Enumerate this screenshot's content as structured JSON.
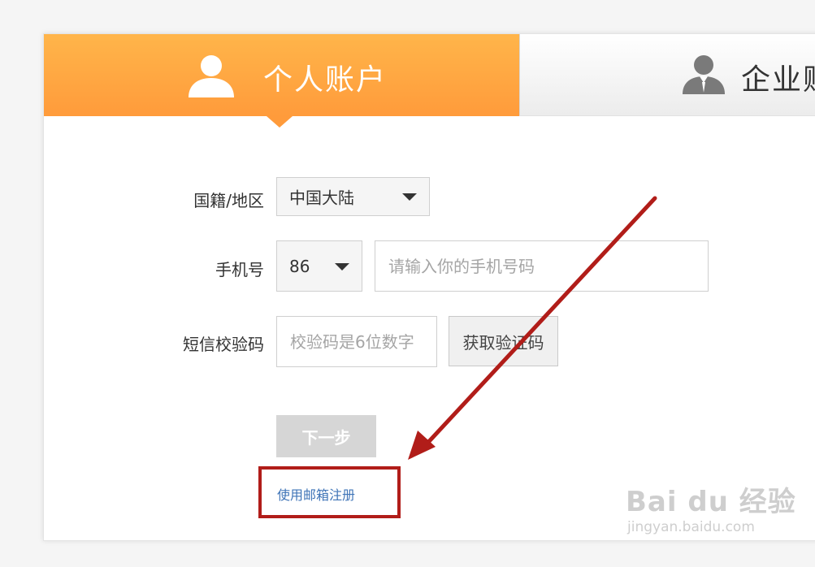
{
  "tabs": {
    "personal": {
      "label": "个人账户",
      "icon": "user-icon",
      "active": true
    },
    "company": {
      "label": "企业账户",
      "icon": "business-user-icon",
      "active": false
    }
  },
  "form": {
    "region": {
      "label": "国籍/地区",
      "value": "中国大陆"
    },
    "phone": {
      "label": "手机号",
      "country_code": "86",
      "placeholder": "请输入你的手机号码"
    },
    "sms": {
      "label": "短信校验码",
      "placeholder": "校验码是6位数字",
      "button": "获取验证码"
    },
    "next_button": "下一步",
    "email_link": "使用邮箱注册"
  },
  "watermark": {
    "logo": "Bai du 经验",
    "url": "jingyan.baidu.com"
  },
  "colors": {
    "tab_active": "#ff9b3b",
    "annotation": "#b11d19",
    "link": "#3f74b7",
    "next_button_bg": "#d6d6d6"
  }
}
